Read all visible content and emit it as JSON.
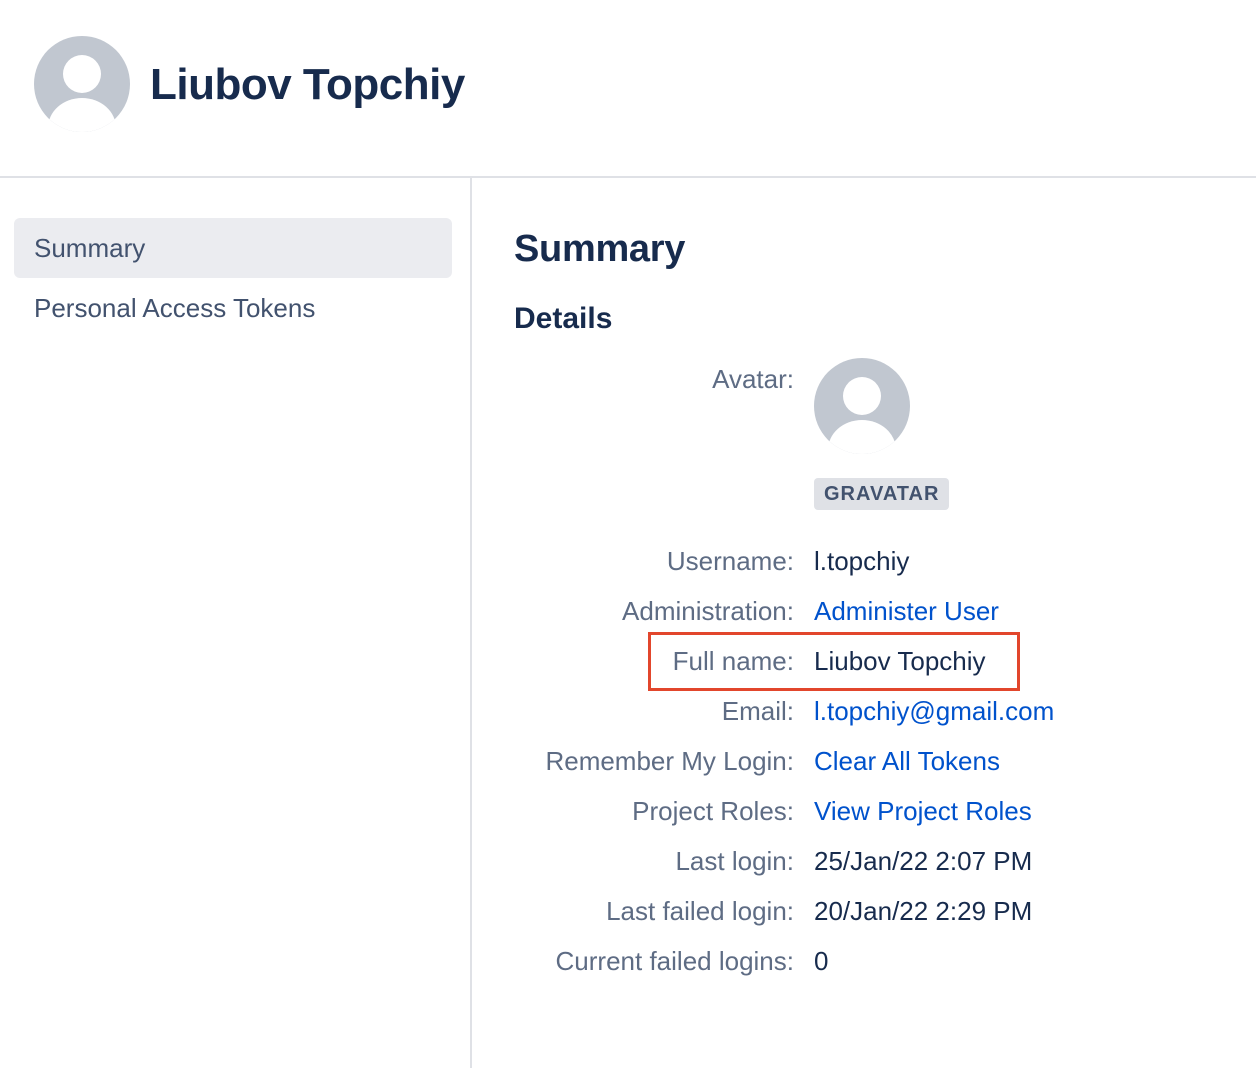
{
  "header": {
    "title": "Liubov Topchiy",
    "avatar_icon": "default-avatar-icon"
  },
  "sidebar": {
    "items": [
      {
        "label": "Summary",
        "active": true
      },
      {
        "label": "Personal Access Tokens",
        "active": false
      }
    ]
  },
  "main": {
    "heading": "Summary",
    "subheading": "Details",
    "avatar": {
      "label": "Avatar:",
      "badge": "GRAVATAR"
    },
    "fields": {
      "username": {
        "label": "Username:",
        "value": "l.topchiy"
      },
      "administration": {
        "label": "Administration:",
        "value": "Administer User"
      },
      "full_name": {
        "label": "Full name:",
        "value": "Liubov Topchiy"
      },
      "email": {
        "label": "Email:",
        "value": "l.topchiy@gmail.com"
      },
      "remember_login": {
        "label": "Remember My Login:",
        "value": "Clear All Tokens"
      },
      "project_roles": {
        "label": "Project Roles:",
        "value": "View Project Roles"
      },
      "last_login": {
        "label": "Last login:",
        "value": "25/Jan/22 2:07 PM"
      },
      "last_failed_login": {
        "label": "Last failed login:",
        "value": "20/Jan/22 2:29 PM"
      },
      "current_failed_logins": {
        "label": "Current failed logins:",
        "value": "0"
      }
    }
  },
  "colors": {
    "link": "#0052cc",
    "text": "#172b4d",
    "label": "#5e6c84",
    "highlight": "#e2462c",
    "active_nav": "#ebecf0"
  }
}
